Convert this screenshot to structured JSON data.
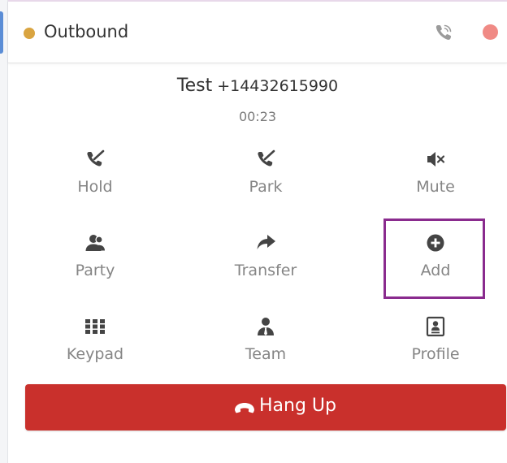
{
  "header": {
    "status_label": "Outbound",
    "status_color": "#d9a441",
    "phone_icon": "phone-ringing-icon",
    "close_color": "#f08a85"
  },
  "call": {
    "name": "Test",
    "number": "+14432615990",
    "timer": "00:23"
  },
  "actions": [
    {
      "label": "Hold",
      "icon": "phone-slash-icon"
    },
    {
      "label": "Park",
      "icon": "phone-slash-icon"
    },
    {
      "label": "Mute",
      "icon": "speaker-mute-icon"
    },
    {
      "label": "Party",
      "icon": "users-icon"
    },
    {
      "label": "Transfer",
      "icon": "share-arrow-icon"
    },
    {
      "label": "Add",
      "icon": "plus-circle-icon"
    },
    {
      "label": "Keypad",
      "icon": "grid-icon"
    },
    {
      "label": "Team",
      "icon": "user-tie-icon"
    },
    {
      "label": "Profile",
      "icon": "contact-card-icon"
    }
  ],
  "hangup": {
    "label": "Hang Up",
    "color": "#c9302c"
  },
  "highlight_color": "#8a2b8e"
}
